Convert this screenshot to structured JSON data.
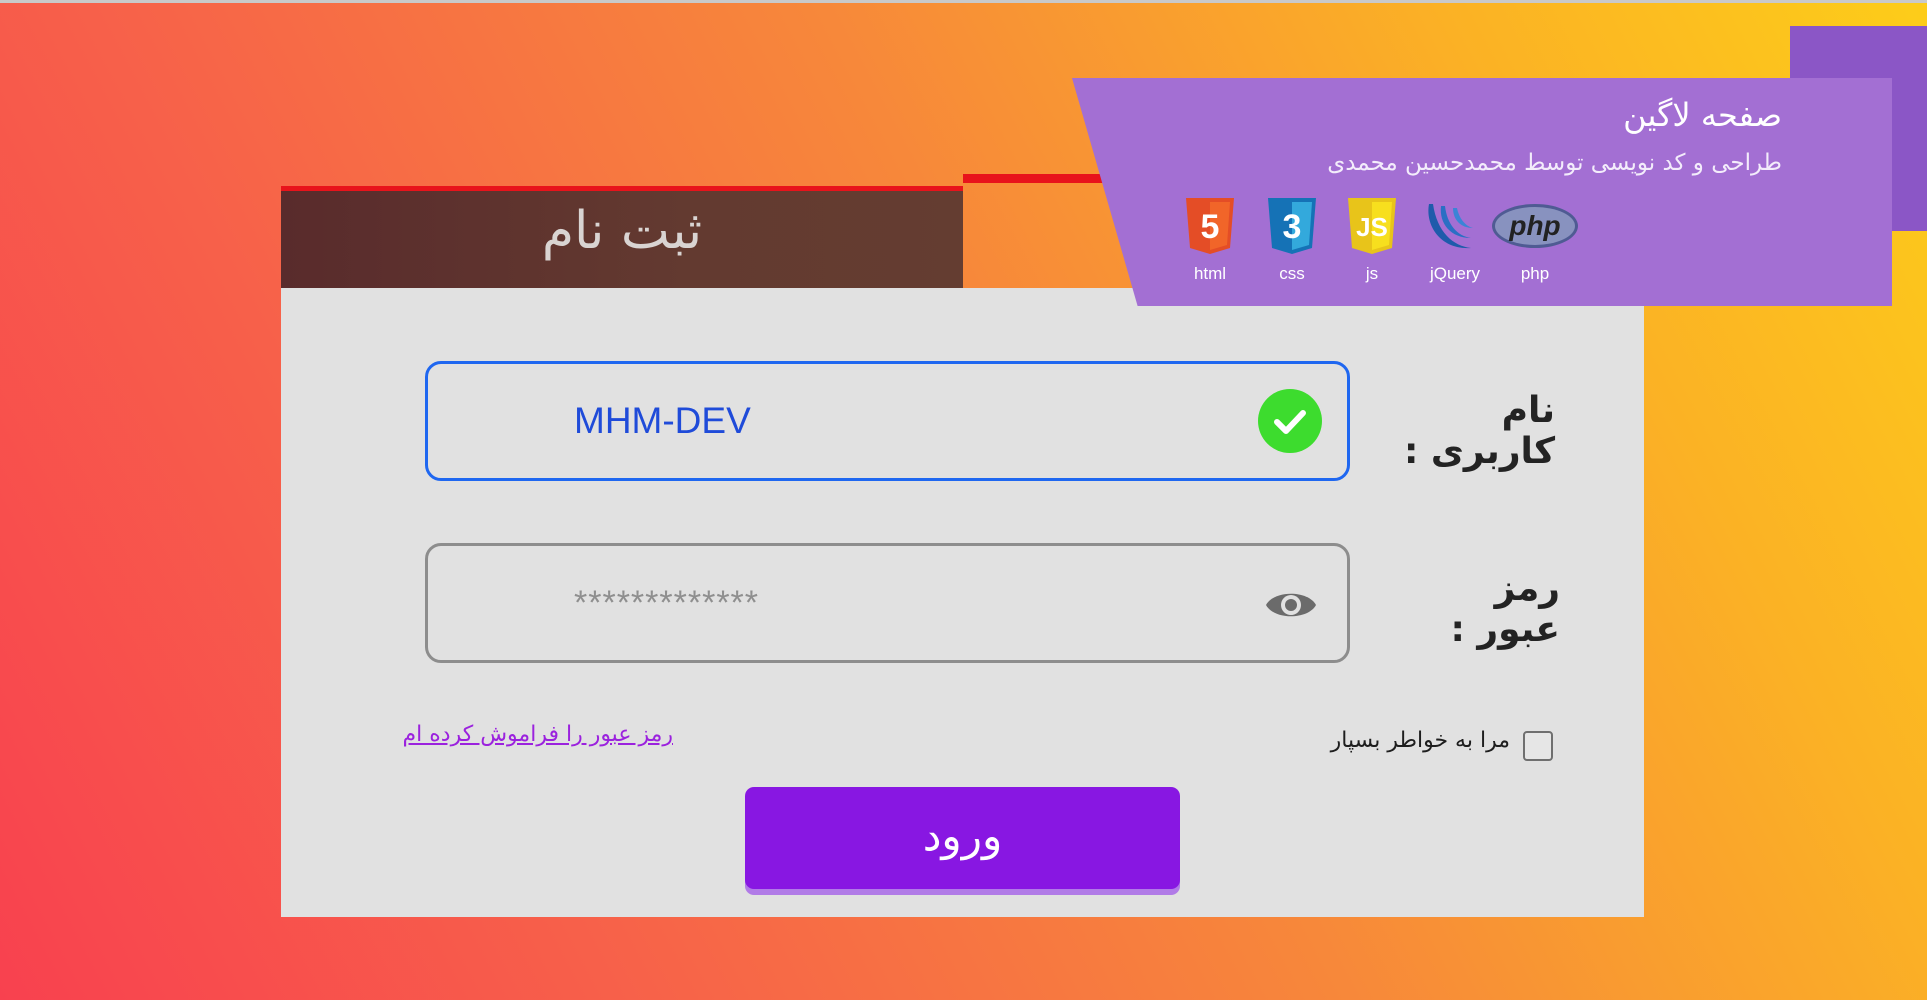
{
  "header": {
    "tab_title": "ثبت نام"
  },
  "ribbon": {
    "title": "صفحه لاگین",
    "subtitle": "طراحی و کد نویسی توسط محمدحسین محمدی",
    "technologies": [
      {
        "label": "html",
        "icon": "html5-icon",
        "color": "#e44d26"
      },
      {
        "label": "css",
        "icon": "css3-icon",
        "color": "#1572b6"
      },
      {
        "label": "js",
        "icon": "javascript-icon",
        "color": "#f7df1e"
      },
      {
        "label": "jQuery",
        "icon": "jquery-icon",
        "color": "#0769ad"
      },
      {
        "label": "php",
        "icon": "php-icon",
        "color": "#777bb3"
      }
    ]
  },
  "form": {
    "username_label": "نام کاربری :",
    "username_value": "MHM-DEV",
    "username_status_icon": "check-circle-icon",
    "password_label": "رمز عبور :",
    "password_value": "*************",
    "password_toggle_icon": "eye-icon",
    "remember_label": "مرا به خواطر بسپار",
    "remember_checked": false,
    "forgot_link": "رمز عبور را فراموش کرده ام",
    "submit_label": "ورود"
  },
  "colors": {
    "accent": "#8817e2",
    "ribbon": "#a36fd3",
    "tab_dark": "#5e3330",
    "tab_line": "#e8131b",
    "valid": "#3ddc2e",
    "focus_border": "#1f67f0"
  }
}
